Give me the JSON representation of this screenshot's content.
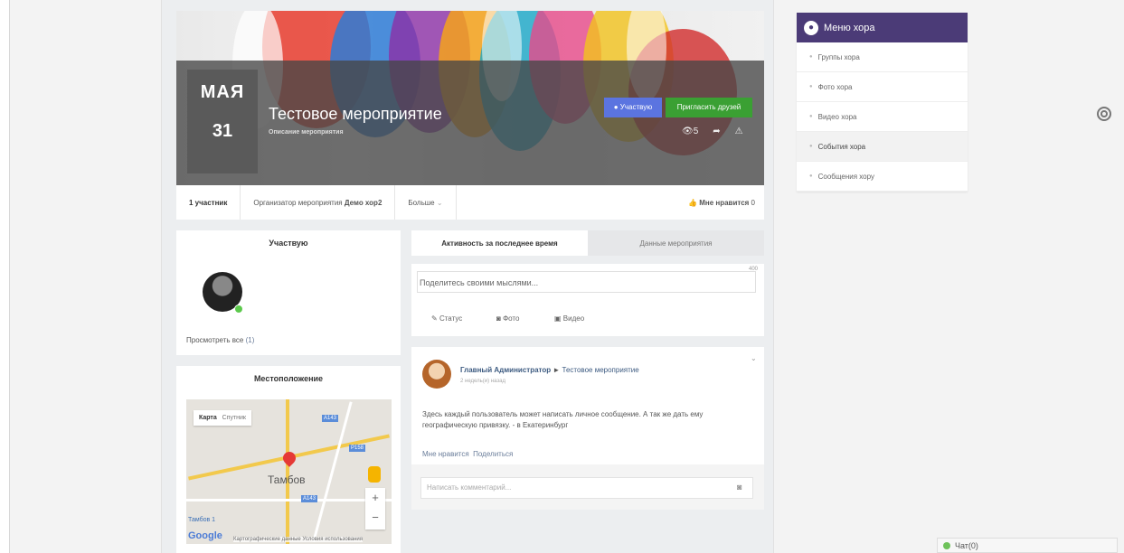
{
  "event": {
    "month": "МАЯ",
    "day": "31",
    "title": "Тестовое мероприятие",
    "subtitle": "Описание мероприятия",
    "going_label": "● Участвую",
    "invite_label": "Пригласить друзей",
    "views": "5"
  },
  "info_bar": {
    "participants": "1 участник",
    "organizer_prefix": "Организатор мероприятия",
    "organizer_name": "Демо хор2",
    "more": "Больше",
    "likes": "Мне нравится",
    "likes_count": "0"
  },
  "going_card": {
    "title": "Участвую",
    "view_all": "Просмотреть все",
    "count": "(1)"
  },
  "location_card": {
    "title": "Местоположение",
    "map_tab": "Карта",
    "satellite_tab": "Спутник",
    "city": "Тамбов",
    "city_small": "Тамбов 1",
    "road_a143": "A143",
    "road_p158": "P158",
    "brand": "Google",
    "footer": "Картографические данные  Условия использования"
  },
  "tabs": {
    "activity": "Активность за последнее время",
    "data": "Данные мероприятия"
  },
  "composer": {
    "counter": "400",
    "placeholder": "Поделитесь своими мыслями...",
    "status": "Статус",
    "photo": "Фото",
    "video": "Видео"
  },
  "post": {
    "author": "Главный Администратор",
    "arrow": "►",
    "target": "Тестовое мероприятие",
    "time": "2 недель(и) назад",
    "text": "Здесь каждый пользователь может написать личное сообщение. А так же дать ему географическую привязку. - в Екатеринбург",
    "like": "Мне нравится",
    "share": "Поделиться",
    "comment_placeholder": "Написать комментарий..."
  },
  "side_menu": {
    "title": "Меню хора",
    "items": [
      "Группы хора",
      "Фото хора",
      "Видео хора",
      "События хора",
      "Сообщения хору"
    ]
  },
  "chat": {
    "label": "Чат(0)"
  }
}
